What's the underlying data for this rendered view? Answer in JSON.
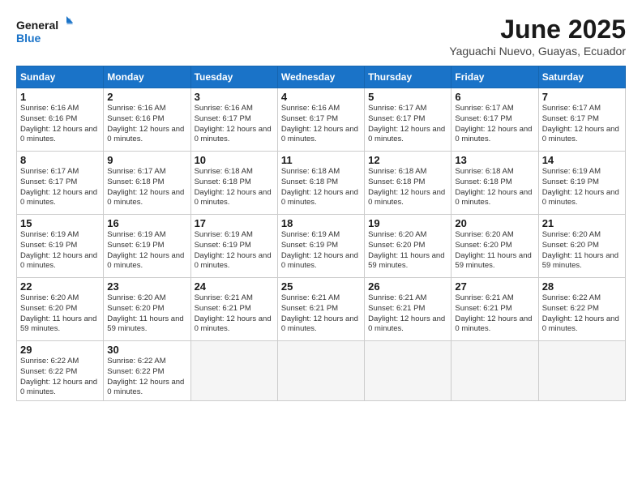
{
  "logo": {
    "text_general": "General",
    "text_blue": "Blue"
  },
  "title": "June 2025",
  "subtitle": "Yaguachi Nuevo, Guayas, Ecuador",
  "days_of_week": [
    "Sunday",
    "Monday",
    "Tuesday",
    "Wednesday",
    "Thursday",
    "Friday",
    "Saturday"
  ],
  "weeks": [
    [
      {
        "day": "1",
        "sunrise": "6:16 AM",
        "sunset": "6:16 PM",
        "daylight": "12 hours and 0 minutes"
      },
      {
        "day": "2",
        "sunrise": "6:16 AM",
        "sunset": "6:16 PM",
        "daylight": "12 hours and 0 minutes"
      },
      {
        "day": "3",
        "sunrise": "6:16 AM",
        "sunset": "6:17 PM",
        "daylight": "12 hours and 0 minutes"
      },
      {
        "day": "4",
        "sunrise": "6:16 AM",
        "sunset": "6:17 PM",
        "daylight": "12 hours and 0 minutes"
      },
      {
        "day": "5",
        "sunrise": "6:17 AM",
        "sunset": "6:17 PM",
        "daylight": "12 hours and 0 minutes"
      },
      {
        "day": "6",
        "sunrise": "6:17 AM",
        "sunset": "6:17 PM",
        "daylight": "12 hours and 0 minutes"
      },
      {
        "day": "7",
        "sunrise": "6:17 AM",
        "sunset": "6:17 PM",
        "daylight": "12 hours and 0 minutes"
      }
    ],
    [
      {
        "day": "8",
        "sunrise": "6:17 AM",
        "sunset": "6:17 PM",
        "daylight": "12 hours and 0 minutes"
      },
      {
        "day": "9",
        "sunrise": "6:17 AM",
        "sunset": "6:18 PM",
        "daylight": "12 hours and 0 minutes"
      },
      {
        "day": "10",
        "sunrise": "6:18 AM",
        "sunset": "6:18 PM",
        "daylight": "12 hours and 0 minutes"
      },
      {
        "day": "11",
        "sunrise": "6:18 AM",
        "sunset": "6:18 PM",
        "daylight": "12 hours and 0 minutes"
      },
      {
        "day": "12",
        "sunrise": "6:18 AM",
        "sunset": "6:18 PM",
        "daylight": "12 hours and 0 minutes"
      },
      {
        "day": "13",
        "sunrise": "6:18 AM",
        "sunset": "6:18 PM",
        "daylight": "12 hours and 0 minutes"
      },
      {
        "day": "14",
        "sunrise": "6:19 AM",
        "sunset": "6:19 PM",
        "daylight": "12 hours and 0 minutes"
      }
    ],
    [
      {
        "day": "15",
        "sunrise": "6:19 AM",
        "sunset": "6:19 PM",
        "daylight": "12 hours and 0 minutes"
      },
      {
        "day": "16",
        "sunrise": "6:19 AM",
        "sunset": "6:19 PM",
        "daylight": "12 hours and 0 minutes"
      },
      {
        "day": "17",
        "sunrise": "6:19 AM",
        "sunset": "6:19 PM",
        "daylight": "12 hours and 0 minutes"
      },
      {
        "day": "18",
        "sunrise": "6:19 AM",
        "sunset": "6:19 PM",
        "daylight": "12 hours and 0 minutes"
      },
      {
        "day": "19",
        "sunrise": "6:20 AM",
        "sunset": "6:20 PM",
        "daylight": "11 hours and 59 minutes"
      },
      {
        "day": "20",
        "sunrise": "6:20 AM",
        "sunset": "6:20 PM",
        "daylight": "11 hours and 59 minutes"
      },
      {
        "day": "21",
        "sunrise": "6:20 AM",
        "sunset": "6:20 PM",
        "daylight": "11 hours and 59 minutes"
      }
    ],
    [
      {
        "day": "22",
        "sunrise": "6:20 AM",
        "sunset": "6:20 PM",
        "daylight": "11 hours and 59 minutes"
      },
      {
        "day": "23",
        "sunrise": "6:20 AM",
        "sunset": "6:20 PM",
        "daylight": "11 hours and 59 minutes"
      },
      {
        "day": "24",
        "sunrise": "6:21 AM",
        "sunset": "6:21 PM",
        "daylight": "12 hours and 0 minutes"
      },
      {
        "day": "25",
        "sunrise": "6:21 AM",
        "sunset": "6:21 PM",
        "daylight": "12 hours and 0 minutes"
      },
      {
        "day": "26",
        "sunrise": "6:21 AM",
        "sunset": "6:21 PM",
        "daylight": "12 hours and 0 minutes"
      },
      {
        "day": "27",
        "sunrise": "6:21 AM",
        "sunset": "6:21 PM",
        "daylight": "12 hours and 0 minutes"
      },
      {
        "day": "28",
        "sunrise": "6:22 AM",
        "sunset": "6:22 PM",
        "daylight": "12 hours and 0 minutes"
      }
    ],
    [
      {
        "day": "29",
        "sunrise": "6:22 AM",
        "sunset": "6:22 PM",
        "daylight": "12 hours and 0 minutes"
      },
      {
        "day": "30",
        "sunrise": "6:22 AM",
        "sunset": "6:22 PM",
        "daylight": "12 hours and 0 minutes"
      },
      null,
      null,
      null,
      null,
      null
    ]
  ]
}
